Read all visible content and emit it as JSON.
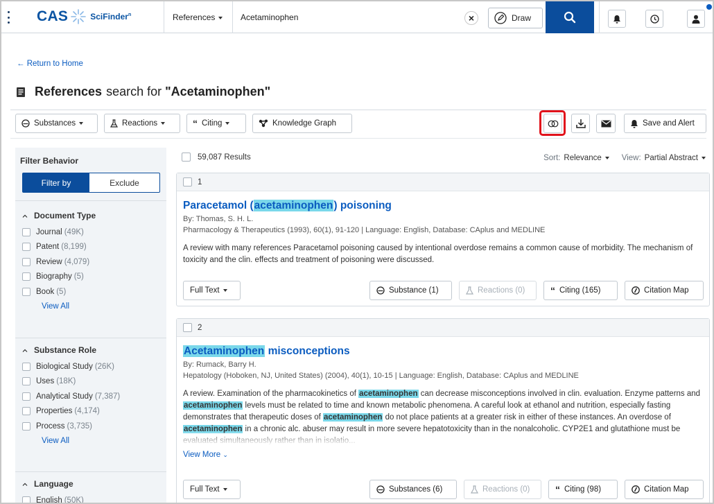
{
  "header": {
    "brand": "CAS",
    "product": "SciFinder",
    "product_mark": "n",
    "search_type": "References",
    "query": "Acetaminophen",
    "draw_label": "Draw"
  },
  "breadcrumb": {
    "back_label": "Return to Home"
  },
  "page": {
    "title_bold": "References",
    "title_mid": "search for",
    "title_query": "\"Acetaminophen\""
  },
  "toolbar": {
    "substances": "Substances",
    "reactions": "Reactions",
    "citing": "Citing",
    "knowledge_graph": "Knowledge Graph",
    "save_alert": "Save and Alert"
  },
  "sidebar": {
    "behavior_title": "Filter Behavior",
    "filter_by": "Filter by",
    "exclude": "Exclude",
    "view_all": "View All",
    "sections": [
      {
        "title": "Document Type",
        "items": [
          {
            "label": "Journal",
            "count": "(49K)"
          },
          {
            "label": "Patent",
            "count": "(8,199)"
          },
          {
            "label": "Review",
            "count": "(4,079)"
          },
          {
            "label": "Biography",
            "count": "(5)"
          },
          {
            "label": "Book",
            "count": "(5)"
          }
        ]
      },
      {
        "title": "Substance Role",
        "items": [
          {
            "label": "Biological Study",
            "count": "(26K)"
          },
          {
            "label": "Uses",
            "count": "(18K)"
          },
          {
            "label": "Analytical Study",
            "count": "(7,387)"
          },
          {
            "label": "Properties",
            "count": "(4,174)"
          },
          {
            "label": "Process",
            "count": "(3,735)"
          }
        ]
      },
      {
        "title": "Language",
        "items": [
          {
            "label": "English",
            "count": "(50K)"
          }
        ]
      }
    ]
  },
  "results": {
    "count": "59,087 Results",
    "sort_label": "Sort:",
    "sort_value": "Relevance",
    "view_label": "View:",
    "view_value": "Partial Abstract",
    "items": [
      {
        "index": "1",
        "title_pre": "Paracetamol (",
        "title_hl": "acetaminophen",
        "title_post": ") poisoning",
        "authors": "By: Thomas, S. H. L.",
        "source": "Pharmacology & Therapeutics (1993), 60(1), 91-120 | Language: English, Database: CAplus and MEDLINE",
        "abstract": "A review with many references Paracetamol poisoning caused by intentional overdose remains a common cause of morbidity. The mechanism of toxicity and the clin. effects and treatment of poisoning were discussed.",
        "full_text": "Full Text",
        "substances": "Substance (1)",
        "reactions": "Reactions (0)",
        "citing": "Citing (165)",
        "citation_map": "Citation Map"
      },
      {
        "index": "2",
        "title_hl": "Acetaminophen",
        "title_post": " misconceptions",
        "authors": "By: Rumack, Barry H.",
        "source": "Hepatology (Hoboken, NJ, United States) (2004), 40(1), 10-15 | Language: English, Database: CAplus and MEDLINE",
        "abstract_parts": [
          "A review. Examination of the pharmacokinetics of ",
          "acetaminophen",
          " can decrease misconceptions involved in clin. evaluation. Enzyme patterns and ",
          "acetaminophen",
          " levels must be related to time and known metabolic phenomena. A careful look at ethanol and nutrition, especially fasting demonstrates that therapeutic doses of ",
          "acetaminophen",
          " do not place patients at a greater risk in either of these instances. An overdose of ",
          "acetaminophen",
          " in a chronic alc. abuser may result in more severe hepatotoxicity than in the nonalcoholic. CYP2E1 and glutathione must be evaluated simultaneously rather than in isolatio..."
        ],
        "view_more": "View More",
        "full_text": "Full Text",
        "substances": "Substances (6)",
        "reactions": "Reactions (0)",
        "citing": "Citing (98)",
        "citation_map": "Citation Map"
      }
    ]
  }
}
